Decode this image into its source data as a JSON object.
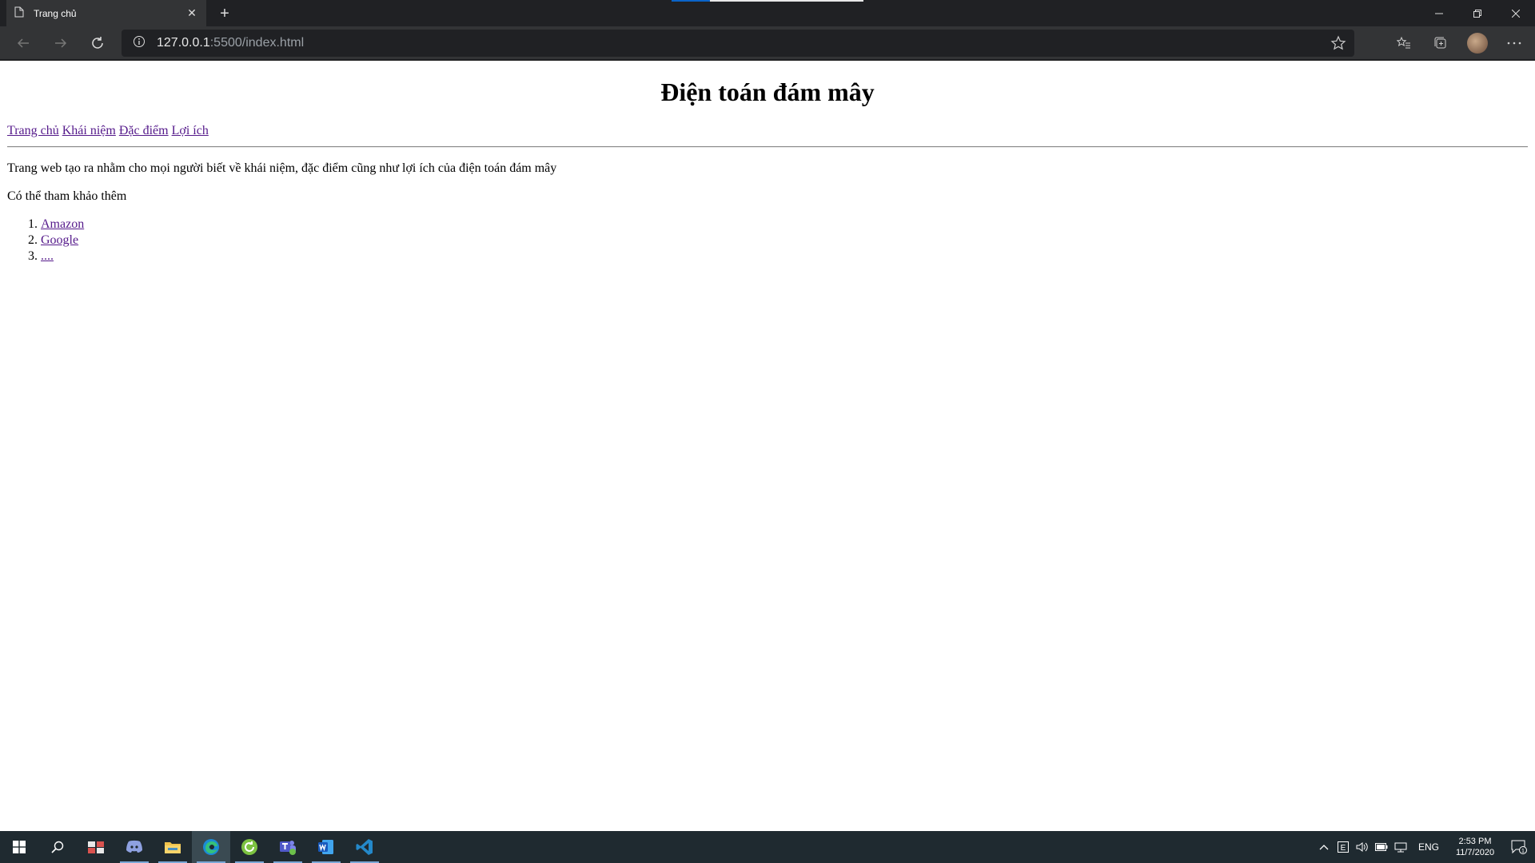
{
  "browser": {
    "tab_title": "Trang chủ",
    "url_host": "127.0.0.1",
    "url_rest": ":5500/index.html"
  },
  "page": {
    "heading": "Điện toán đám mây",
    "nav": [
      {
        "label": "Trang chủ"
      },
      {
        "label": "Khái niệm"
      },
      {
        "label": "Đặc điểm"
      },
      {
        "label": "Lợi ích"
      }
    ],
    "intro": "Trang web tạo ra nhằm cho mọi người biết về khái niệm, đặc điểm cũng như lợi ích của điện toán đám mây",
    "more_label": "Có thể tham khảo thêm",
    "links": [
      {
        "label": "Amazon"
      },
      {
        "label": "Google"
      },
      {
        "label": "...."
      }
    ]
  },
  "taskbar": {
    "apps": [
      "windows-start-icon",
      "search-icon",
      "tool-app-icon",
      "discord-icon",
      "file-explorer-icon",
      "edge-icon",
      "refresh-app-icon",
      "teams-icon",
      "word-icon",
      "vscode-icon"
    ],
    "language": "ENG",
    "time": "2:53 PM",
    "date": "11/7/2020",
    "notification_count": "1"
  },
  "colors": {
    "link_visited": "#551a8b",
    "taskbar_bg": "#1f2a30",
    "chrome_bg": "#333436"
  }
}
